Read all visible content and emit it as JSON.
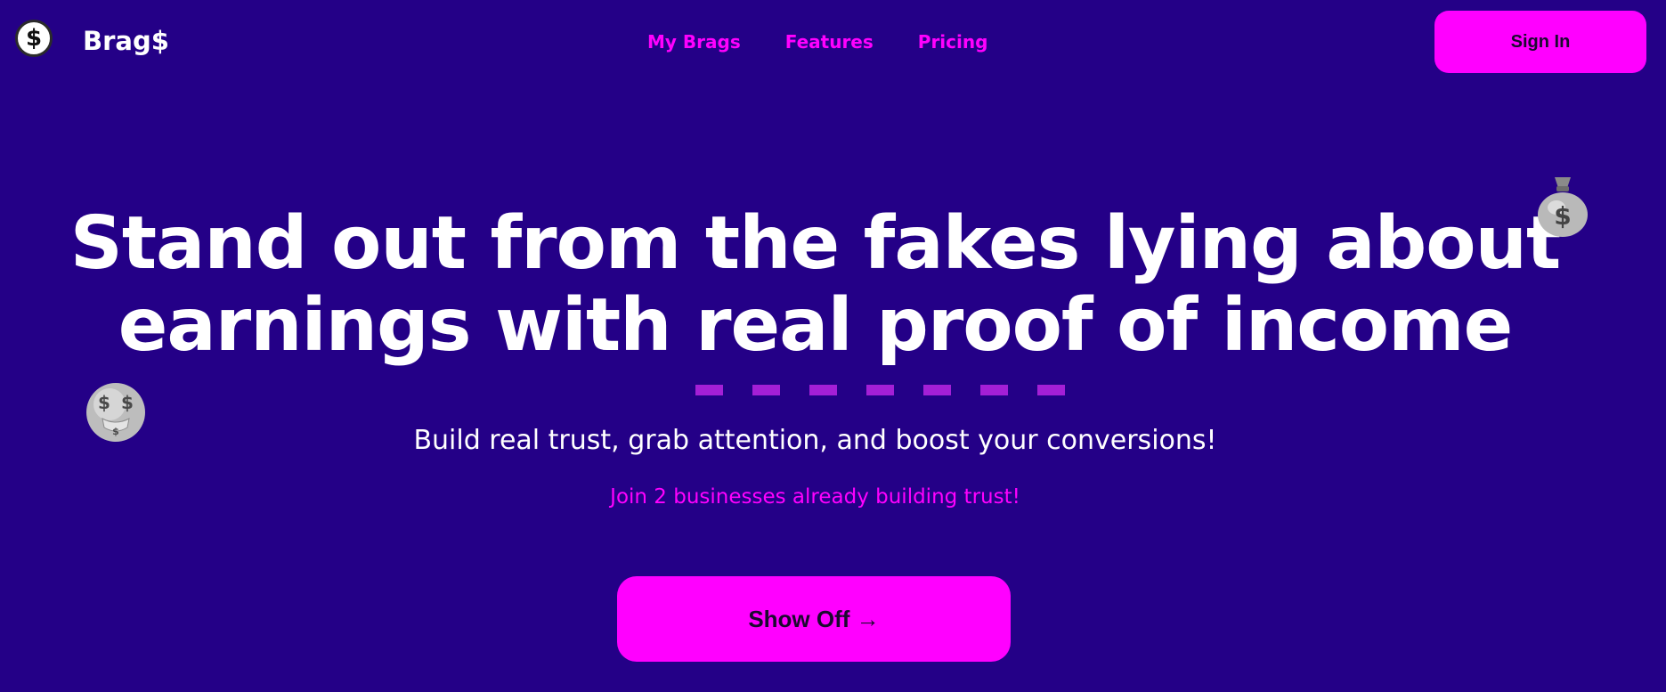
{
  "header": {
    "brand_name": "Brag$",
    "logo_symbol": "$",
    "nav": [
      {
        "label": "My Brags"
      },
      {
        "label": "Features"
      },
      {
        "label": "Pricing"
      }
    ],
    "signin_label": "Sign In"
  },
  "hero": {
    "headline_line1": "Stand out from the fakes lying about",
    "headline_line2": "earnings with real proof of income",
    "subtitle": "Build real trust, grab attention, and boost your conversions!",
    "join_text": "Join 2 businesses already building trust!",
    "cta_label": "Show Off →"
  },
  "icons": {
    "logo": "dollar-coin-icon",
    "top_right_emoji": "money-bag-icon",
    "left_emoji": "money-mouth-face-icon"
  },
  "colors": {
    "background": "#240087",
    "accent": "#ff00ff",
    "underline": "#a41fd6",
    "text": "#ffffff"
  }
}
